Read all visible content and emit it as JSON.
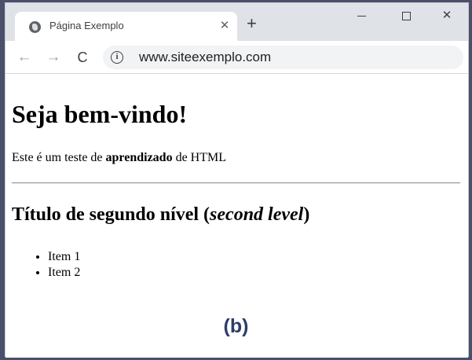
{
  "browser": {
    "tab": {
      "title": "Página Exemplo",
      "close_glyph": "✕",
      "favicon": "globe-icon"
    },
    "new_tab_glyph": "+",
    "window_controls": {
      "close_glyph": "✕"
    },
    "nav": {
      "back_glyph": "←",
      "forward_glyph": "→",
      "reload_glyph": "C"
    },
    "address": {
      "info_glyph": "i",
      "url": "www.siteexemplo.com"
    }
  },
  "page": {
    "heading1": "Seja bem-vindo!",
    "paragraph": {
      "before": "Este é um teste de ",
      "bold": "aprendizado",
      "after": " de HTML"
    },
    "heading2": {
      "before": "Título de segundo nível (",
      "italic": "second level",
      "after": ")"
    },
    "list_items": [
      "Item 1",
      "Item 2"
    ]
  },
  "caption": "(b)",
  "colors": {
    "tabbar": "#dfe2e7",
    "omnibox": "#f1f3f4",
    "caption": "#2f3d6a",
    "frame": "#4a4f6a"
  }
}
